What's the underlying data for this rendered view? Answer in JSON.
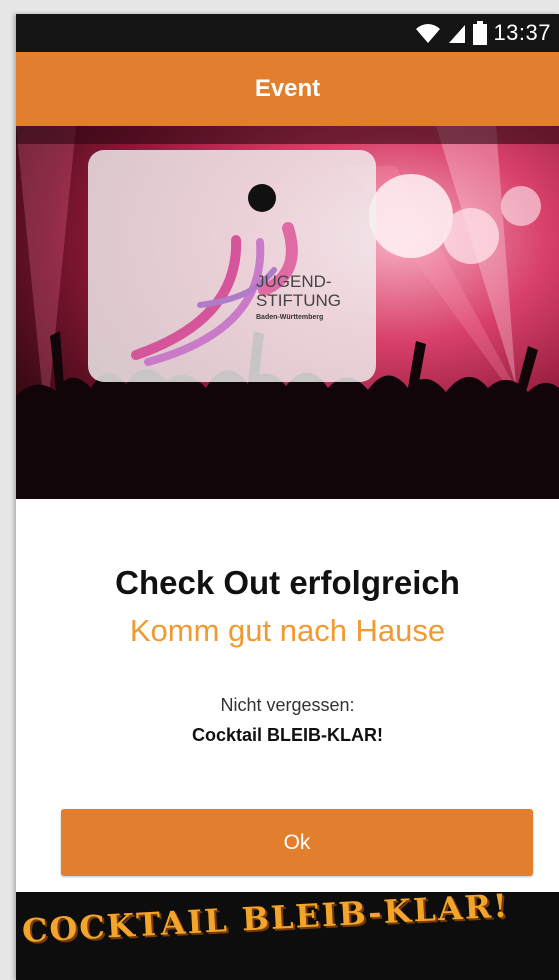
{
  "status_bar": {
    "time": "13:37",
    "icons": [
      "wifi-icon",
      "signal-icon",
      "battery-icon"
    ]
  },
  "nav": {
    "title": "Event"
  },
  "hero": {
    "logo_line1": "JUGEND-",
    "logo_line2": "STIFTUNG",
    "logo_sub": "Baden-Württemberg"
  },
  "content": {
    "headline": "Check Out erfolgreich",
    "subline": "Komm gut nach Hause",
    "reminder_label": "Nicht vergessen:",
    "reminder_value": "Cocktail BLEIB-KLAR!",
    "ok_label": "Ok"
  },
  "banner": {
    "text": "COCKTAIL BLEIB-KLAR!"
  },
  "colors": {
    "accent": "#e27f2f",
    "subline": "#f19a32",
    "statusbar": "#141414"
  }
}
